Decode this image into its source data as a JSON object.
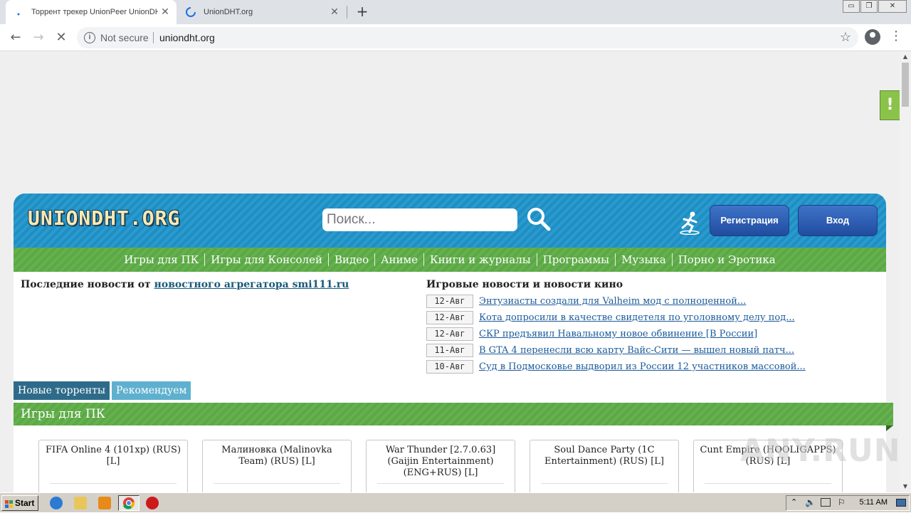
{
  "browser": {
    "tabs": [
      {
        "title": "Торрент трекер UnionPeer UnionDHT",
        "active": true
      },
      {
        "title": "UnionDHT.org",
        "active": false
      }
    ],
    "close_glyph": "✕",
    "new_tab_glyph": "+",
    "security_label": "Not secure",
    "url": "uniondht.org",
    "window_controls": [
      "▭",
      "❐",
      "✕"
    ]
  },
  "site": {
    "logo": "UNIONDHT.ORG",
    "search_placeholder": "Поиск...",
    "register_label": "Регистрация",
    "login_label": "Вход",
    "categories": [
      "Игры для ПК",
      "Игры для Консолей",
      "Видео",
      "Аниме",
      "Книги и журналы",
      "Программы",
      "Музыка",
      "Порно и Эротика"
    ],
    "news_left": {
      "prefix": "Последние новости от ",
      "link": "новостного агрегатора smi111.ru"
    },
    "news_right_title": "Игровые новости и новости кино",
    "news": [
      {
        "date": "12-Авг",
        "title": "Энтузиасты создали для Valheim мод с полноценной..."
      },
      {
        "date": "12-Авг",
        "title": "Кота допросили в качестве свидетеля по уголовному делу под..."
      },
      {
        "date": "12-Авг",
        "title": "СКР предъявил Навальному новое обвинение [В России]"
      },
      {
        "date": "11-Авг",
        "title": "В GTA 4 перенесли всю карту Вайс-Сити — вышел новый патч..."
      },
      {
        "date": "10-Авг",
        "title": "Суд в Подмосковье выдворил из России 12 участников массовой..."
      }
    ],
    "tabs": [
      "Новые торренты",
      "Рекомендуем"
    ],
    "section_title": "Игры для ПК",
    "cards": [
      "FIFA Online 4 (101xp) (RUS) [L]",
      "Малиновка (Malinovka Team) (RUS) [L]",
      "War Thunder [2.7.0.63] (Gaijin Entertainment) (ENG+RUS) [L]",
      "Soul Dance Party (1C Entertainment) (RUS) [L]",
      "Cunt Empire (HOOLIGAPPS) (RUS) [L]"
    ],
    "notification_glyph": "!"
  },
  "taskbar": {
    "start_label": "Start",
    "clock": "5:11 AM"
  },
  "watermark": "ANY.RUN",
  "colors": {
    "header_blue": "#1f8ec0",
    "nav_green": "#5ba845",
    "button_blue": "#2f5fb3",
    "link_blue": "#1a5a9a"
  }
}
